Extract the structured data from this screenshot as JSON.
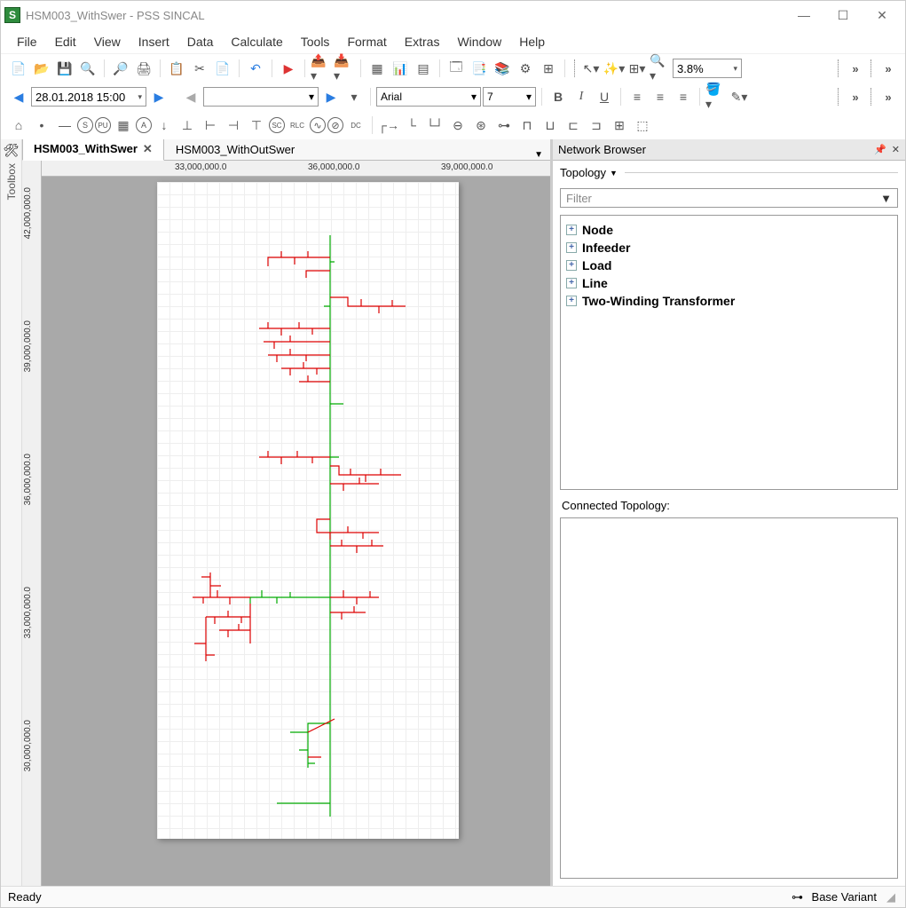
{
  "title": "HSM003_WithSwer - PSS SINCAL",
  "menu": [
    "File",
    "Edit",
    "View",
    "Insert",
    "Data",
    "Calculate",
    "Tools",
    "Format",
    "Extras",
    "Window",
    "Help"
  ],
  "date_value": "28.01.2018 15:00",
  "font_name": "Arial",
  "font_size": "7",
  "zoom": "3.8%",
  "ruler_h": [
    "33,000,000.0",
    "36,000,000.0",
    "39,000,000.0"
  ],
  "ruler_v": [
    "42,000,000.0",
    "39,000,000.0",
    "36,000,000.0",
    "33,000,000.0",
    "30,000,000.0"
  ],
  "tabs": [
    {
      "label": "HSM003_WithSwer",
      "active": true,
      "closable": true
    },
    {
      "label": "HSM003_WithOutSwer",
      "active": false,
      "closable": false
    }
  ],
  "toolbox_label": "Toolbox",
  "browser": {
    "title": "Network Browser",
    "topology_label": "Topology",
    "filter_placeholder": "Filter",
    "tree": [
      "Node",
      "Infeeder",
      "Load",
      "Line",
      "Two-Winding Transformer"
    ],
    "connected_label": "Connected Topology:"
  },
  "status": {
    "left": "Ready",
    "right": "Base Variant"
  }
}
